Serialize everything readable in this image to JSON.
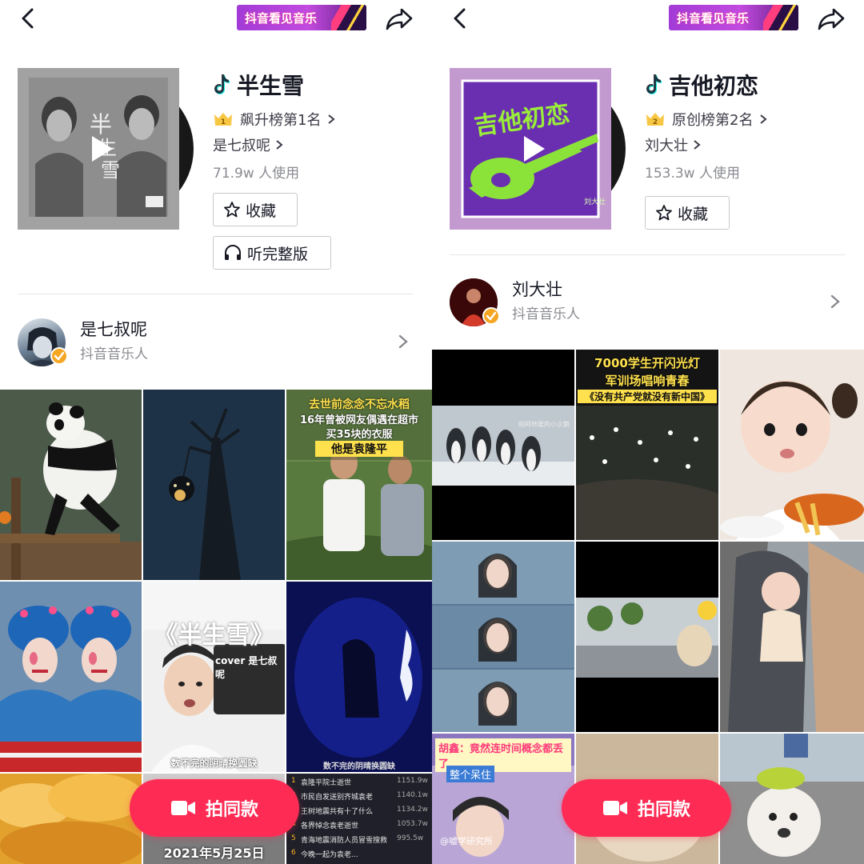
{
  "left": {
    "banner_text": "抖音看见音乐",
    "song_title": "半生雪",
    "rank_label": "飙升榜第1名",
    "rank_badge": "1",
    "artist": "是七叔呢",
    "usage": "71.9w 人使用",
    "favorite_label": "收藏",
    "full_version_label": "听完整版",
    "creator_name": "是七叔呢",
    "creator_role": "抖音音乐人",
    "video_texts": {
      "v3_line1": "去世前念念不忘水稻",
      "v3_line2": "16年曾被网友偶遇在超市",
      "v3_line3": "买35块的衣服",
      "v3_line4": "他是袁隆平",
      "v5_title": "《半生雪》",
      "v5_cover": "cover 是七叔呢",
      "v5_caption": "数不完的阴晴换圆缺",
      "v6_caption": "数不完的阴晴换圆缺",
      "v8_caption": "2021年5月25日"
    },
    "news_list": [
      {
        "rank": "1",
        "text": "袁隆平院士逝世",
        "count": "1151.9w"
      },
      {
        "rank": "2",
        "text": "市民自发送别齐城袁老",
        "count": "1140.1w"
      },
      {
        "rank": "3",
        "text": "王树地震共有十了什么",
        "count": "1134.2w"
      },
      {
        "rank": "4",
        "text": "各界悼念袁老逝世",
        "count": "1053.7w"
      },
      {
        "rank": "5",
        "text": "青海地震消防人员冒雪搜救",
        "count": "995.5w"
      },
      {
        "rank": "6",
        "text": "今晚一起为袁老...",
        "count": ""
      }
    ],
    "shoot_label": "拍同款"
  },
  "right": {
    "banner_text": "抖音看见音乐",
    "song_title": "吉他初恋",
    "cover_text": "吉他初恋",
    "rank_label": "原创榜第2名",
    "rank_badge": "2",
    "artist": "刘大壮",
    "usage": "153.3w 人使用",
    "favorite_label": "收藏",
    "creator_name": "刘大壮",
    "creator_role": "抖音音乐人",
    "video_texts": {
      "v2_line1": "7000学生开闪光灯",
      "v2_line2": "军训场唱响青春",
      "v2_line3": "《没有共产党就没有新中国》",
      "v1_caption": "帕阿地著的小企鹅",
      "v7_line1": "胡鑫：竟然连时间概念都丢了",
      "v7_line2": "整个呆住",
      "v7_watermark": "@嘘学研究所"
    },
    "shoot_label": "拍同款"
  },
  "colors": {
    "accent": "#fe2c55",
    "verified": "#f5a623",
    "text_primary": "#161823",
    "text_secondary": "#8a8b91",
    "tiktok_cyan": "#25f4ee"
  },
  "icons": [
    "back-arrow-icon",
    "share-icon",
    "play-icon",
    "music-note-icon",
    "crown-icon",
    "star-icon",
    "headphones-icon",
    "chevron-right-icon",
    "verified-icon",
    "video-camera-icon"
  ]
}
